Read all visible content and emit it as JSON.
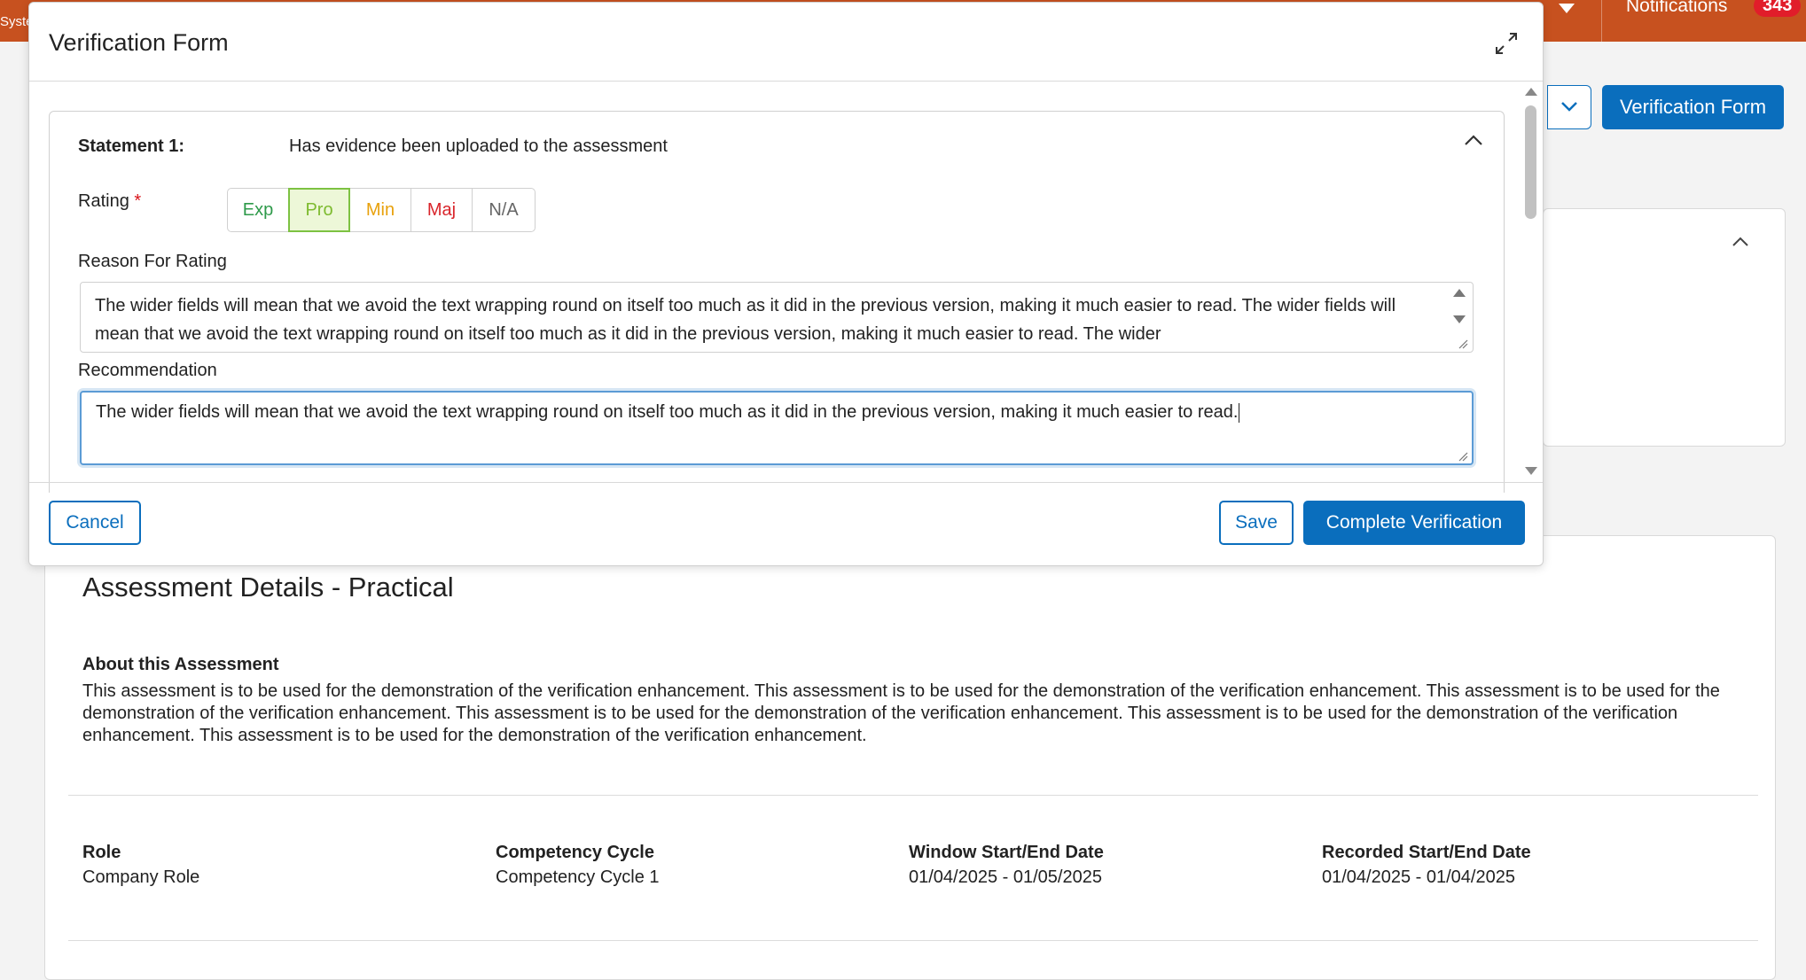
{
  "topbar": {
    "brand_stub": "Syste",
    "notifications_label": "Notifications",
    "notifications_count": "343",
    "accent": "#c7511f"
  },
  "background": {
    "verification_form_button": "Verification Form",
    "assessment_title": "Assessment Details - Practical",
    "about_heading": "About this Assessment",
    "about_text": "This assessment is to be used for the demonstration of the verification enhancement. This assessment is to be used for the demonstration of the verification enhancement. This assessment is to be used for the demonstration of the verification enhancement. This assessment is to be used for the demonstration of the verification enhancement. This assessment is to be used for the demonstration of the verification enhancement. This assessment is to be used for the demonstration of the verification enhancement.",
    "details": [
      {
        "label": "Role",
        "value": "Company Role"
      },
      {
        "label": "Competency Cycle",
        "value": "Competency Cycle 1"
      },
      {
        "label": "Window Start/End Date",
        "value": "01/04/2025 - 01/05/2025"
      },
      {
        "label": "Recorded Start/End Date",
        "value": "01/04/2025 - 01/04/2025"
      }
    ]
  },
  "modal": {
    "title": "Verification Form",
    "statement": {
      "label": "Statement 1:",
      "text": "Has evidence been uploaded to the assessment"
    },
    "rating": {
      "label": "Rating",
      "required_marker": "*",
      "options": [
        {
          "label": "Exp",
          "color": "#2e9a4a",
          "selected": false
        },
        {
          "label": "Pro",
          "color": "#7dbb2f",
          "selected": true
        },
        {
          "label": "Min",
          "color": "#e8a10c",
          "selected": false
        },
        {
          "label": "Maj",
          "color": "#d9252b",
          "selected": false
        },
        {
          "label": "N/A",
          "color": "#666666",
          "selected": false
        }
      ]
    },
    "reason": {
      "label": "Reason For Rating",
      "value": "The wider fields will mean that we avoid the text wrapping round on itself too much as it did in the previous version, making it much easier to read. The wider fields will mean that we avoid the text wrapping round on itself too much as it did in the previous version, making it much easier to read. The wider"
    },
    "recommendation": {
      "label": "Recommendation",
      "value": "The wider fields will mean that we avoid the text wrapping round on itself too much as it did in the previous version, making it much easier to read."
    },
    "buttons": {
      "cancel": "Cancel",
      "save": "Save",
      "complete": "Complete Verification"
    },
    "primary_color": "#0a6ebd"
  }
}
